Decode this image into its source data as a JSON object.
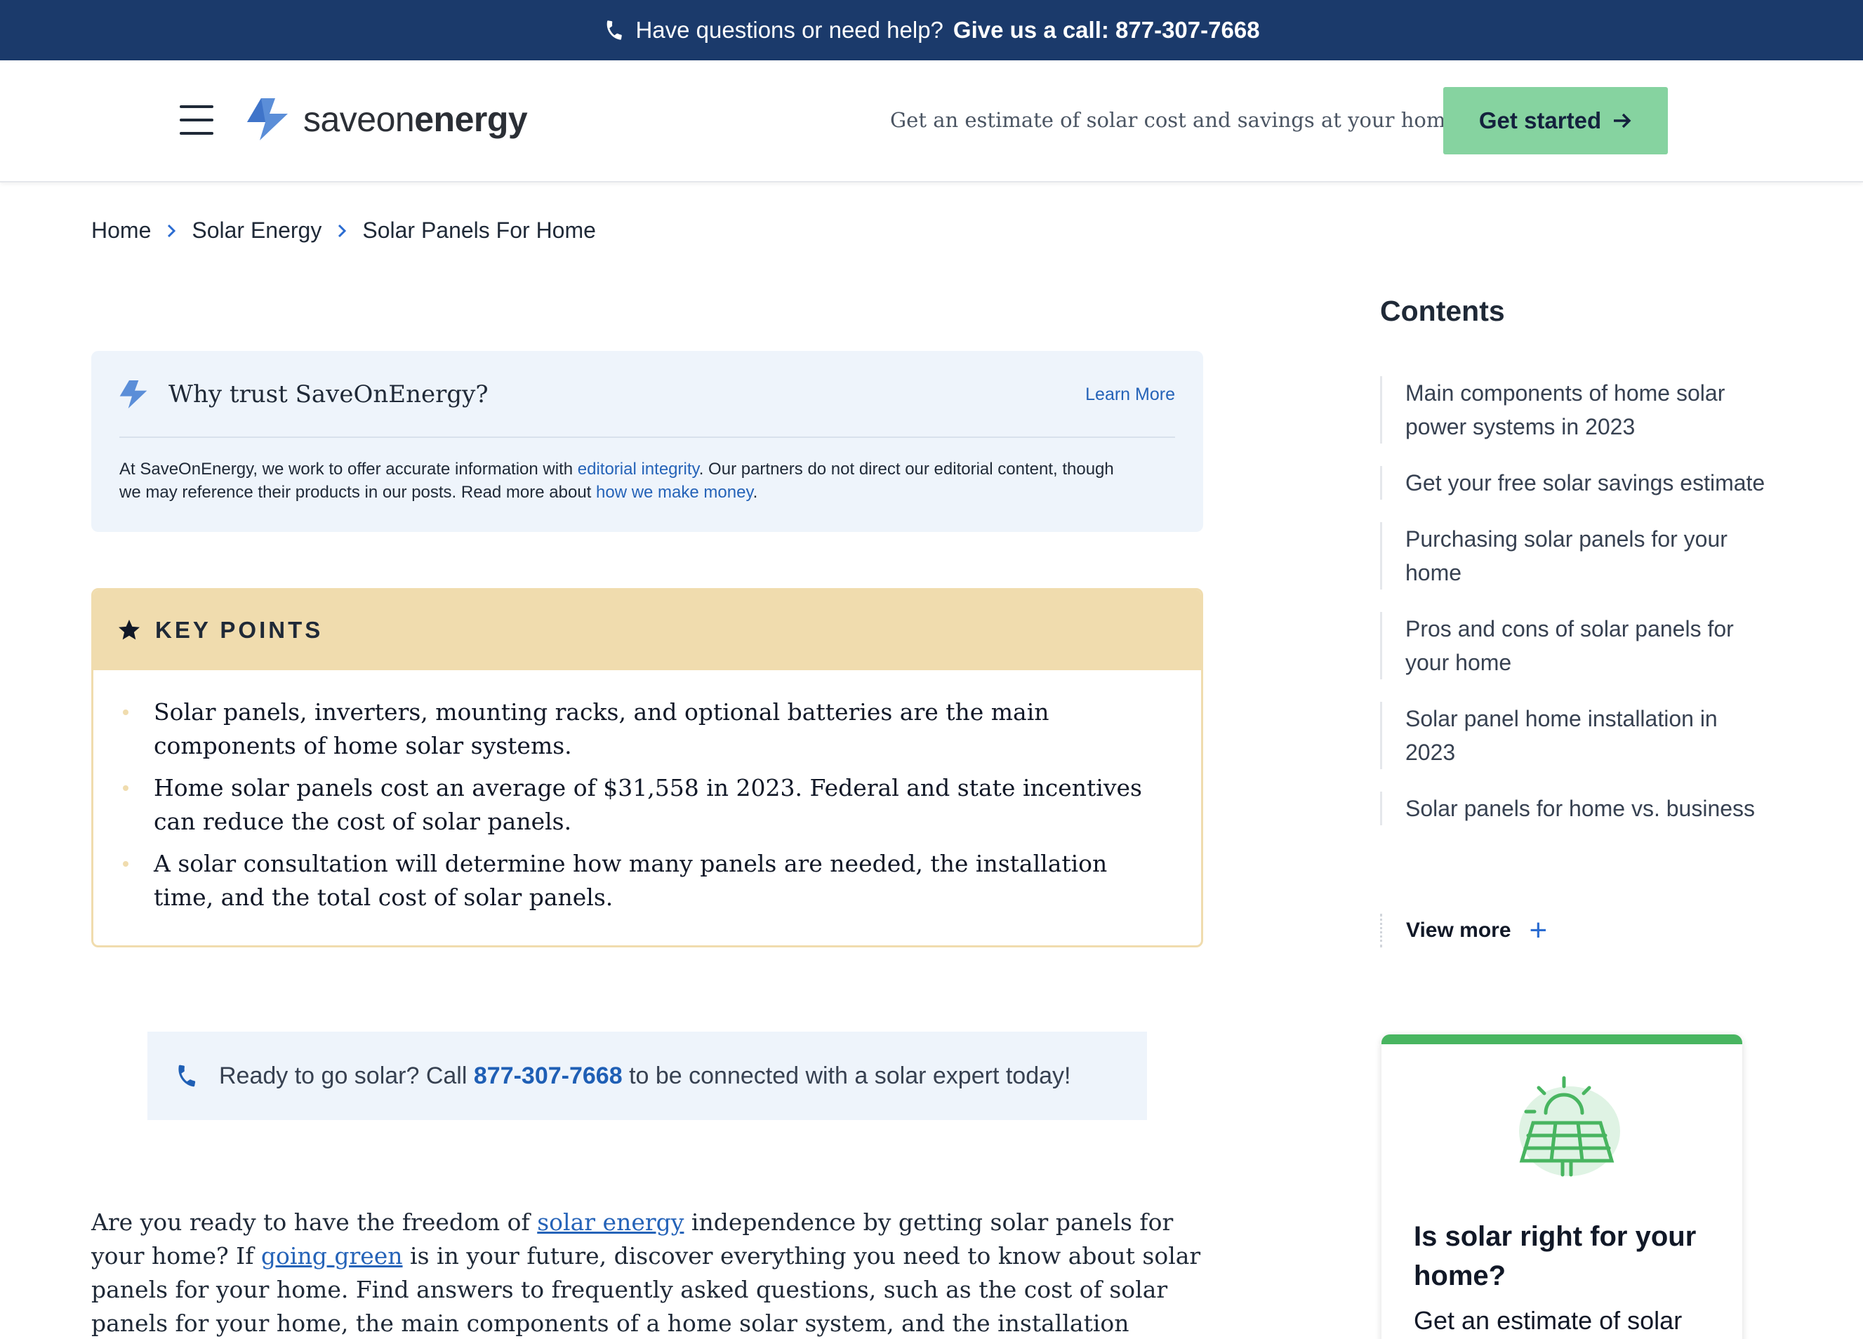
{
  "topbar": {
    "question": "Have questions or need help?",
    "call_text": "Give us a call: 877-307-7668"
  },
  "header": {
    "logo_regular": "saveon",
    "logo_bold": "energy",
    "tagline": "Get an estimate of solar cost and savings at your home.",
    "cta_label": "Get started"
  },
  "breadcrumb": {
    "items": [
      "Home",
      "Solar Energy",
      "Solar Panels For Home"
    ]
  },
  "trust": {
    "title": "Why trust SaveOnEnergy?",
    "learn_more": "Learn More",
    "body_1": "At SaveOnEnergy, we work to offer accurate information with ",
    "link_1": "editorial integrity",
    "body_2": ". Our partners do not direct our editorial content, though we may reference their products in our posts. Read more about ",
    "link_2": "how we make money",
    "body_3": "."
  },
  "key_points": {
    "title": "KEY POINTS",
    "items": [
      "Solar panels, inverters, mounting racks, and optional batteries are the main components of home solar systems.",
      "Home solar panels cost an average of $31,558 in 2023. Federal and state incentives can reduce the cost of solar panels.",
      "A solar consultation will determine how many panels are needed, the installation time, and the total cost of solar panels."
    ]
  },
  "call_banner": {
    "before": "Ready to go solar? Call ",
    "phone": "877-307-7668",
    "after": " to be connected with a solar expert today!"
  },
  "intro": {
    "t1": "Are you ready to have the freedom of ",
    "link_1": "solar energy",
    "t2": " independence by getting solar panels for your home? If ",
    "link_2": "going green",
    "t3": " is in your future, discover everything you need to know about solar panels for your home. Find answers to frequently asked questions, such as the cost of solar panels for your home, the main components of a home solar system, and the installation process."
  },
  "contents": {
    "title": "Contents",
    "items": [
      "Main components of home solar power systems in 2023",
      "Get your free solar savings estimate",
      "Purchasing solar panels for your home",
      "Pros and cons of solar panels for your home",
      "Solar panel home installation in 2023",
      "Solar panels for home vs. business"
    ],
    "view_more": "View more",
    "view_more_icon": "+"
  },
  "card": {
    "title": "Is solar right for your home?",
    "subtitle": "Get an estimate of solar"
  },
  "colors": {
    "topbar": "#1b3a6b",
    "cta": "#86d3a0",
    "accent_blue": "#2563b8",
    "key_points": "#f0dcae",
    "card_accent": "#48b560"
  },
  "icons": [
    "phone-icon",
    "menu-icon",
    "logo-bolt-icon",
    "arrow-right-icon",
    "chevron-right-icon",
    "star-icon",
    "plus-icon",
    "solar-panel-icon"
  ]
}
